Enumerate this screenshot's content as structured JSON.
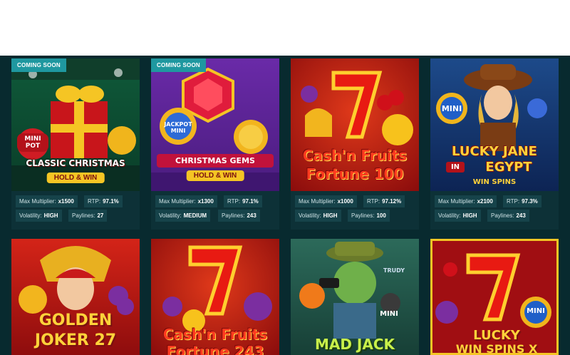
{
  "games": [
    {
      "badge": "COMING SOON",
      "title": "CLASSIC CHRISTMAS",
      "subtitle": "HOLD & WIN",
      "tag": "MINI POT",
      "max_multiplier": "x1500",
      "rtp": "97.1%",
      "volatility": "HIGH",
      "paylines": "27"
    },
    {
      "badge": "COMING SOON",
      "title": "CHRISTMAS GEMS",
      "subtitle": "HOLD & WIN",
      "tag": "JACKPOT MINI",
      "max_multiplier": "x1300",
      "rtp": "97.1%",
      "volatility": "MEDIUM",
      "paylines": "243"
    },
    {
      "badge": "",
      "title": "Cash'n Fruits",
      "subtitle": "Fortune 100",
      "tag": "",
      "max_multiplier": "x1000",
      "rtp": "97.12%",
      "volatility": "HIGH",
      "paylines": "100"
    },
    {
      "badge": "",
      "title": "LUCKY JANE",
      "subtitle": "WIN SPINS",
      "title2": "EGYPT",
      "title_in": "IN",
      "tag": "MINI",
      "max_multiplier": "x2100",
      "rtp": "97.3%",
      "volatility": "HIGH",
      "paylines": "243"
    },
    {
      "badge": "",
      "title": "GOLDEN",
      "subtitle": "JOKER 27"
    },
    {
      "badge": "",
      "title": "Cash'n Fruits",
      "subtitle": "Fortune 243"
    },
    {
      "badge": "",
      "title": "MAD JACK",
      "tag": "MINI",
      "sign": "TRUDY"
    },
    {
      "badge": "",
      "title": "LUCKY",
      "subtitle": "WIN SPINS X",
      "tag": "MINI"
    }
  ],
  "labels": {
    "max_multiplier": "Max Multiplier:",
    "rtp": "RTP:",
    "volatility": "Volatility:",
    "paylines": "Paylines:"
  },
  "colors": {
    "page_bg": "#082a2f",
    "card_bg": "#0d3137",
    "pill_bg": "#16434a",
    "badge_bg": "#1f98a0"
  }
}
